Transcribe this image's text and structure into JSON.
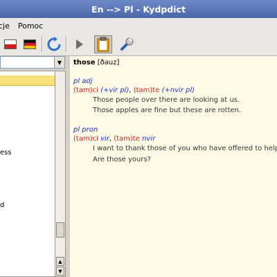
{
  "window": {
    "title": "En --> Pl - Kydpdict"
  },
  "menu": {
    "items": [
      "cje",
      "Pomoc"
    ]
  },
  "toolbar": {
    "buttons": [
      "flag-en-pl-button",
      "flag-de-pl-button",
      "refresh-button",
      "play-button",
      "clipboard-button",
      "settings-button"
    ],
    "flag_colors": {
      "pl_white": "#ffffff",
      "pl_red": "#d21e1e",
      "de_black": "#111111",
      "de_red": "#d21e1e",
      "de_gold": "#f2c200"
    }
  },
  "sidebar": {
    "search_value": "",
    "words": [
      "",
      "",
      "",
      "",
      "",
      "ess",
      "",
      "",
      "",
      "",
      "",
      "d"
    ]
  },
  "entry": {
    "headword": "those",
    "pronunciation": "[ðəuz]",
    "sections": [
      {
        "pos": "pl adj",
        "forms": [
          {
            "pl": "(tam)ci",
            "note": "(+vir pl)"
          },
          {
            "pl": "(tam)te",
            "note": "(+nvir pl)"
          }
        ],
        "examples": [
          "Those people over there are looking at us.",
          "Those apples are fine but these are rotten."
        ]
      },
      {
        "pos": "pl pron",
        "forms": [
          {
            "pl": "(tam)ci",
            "note": "vir"
          },
          {
            "pl": "(tam)te",
            "note": "nvir"
          }
        ],
        "examples": [
          "I want to thank those of you who have offered to help.",
          "Are those yours?"
        ]
      }
    ]
  },
  "colors": {
    "title_bar": "#4a66a8",
    "selection": "#f5e27b",
    "definition_bg": "#fdfbe6",
    "pos_blue": "#1c2fd6",
    "polish_red": "#d21e1e"
  }
}
